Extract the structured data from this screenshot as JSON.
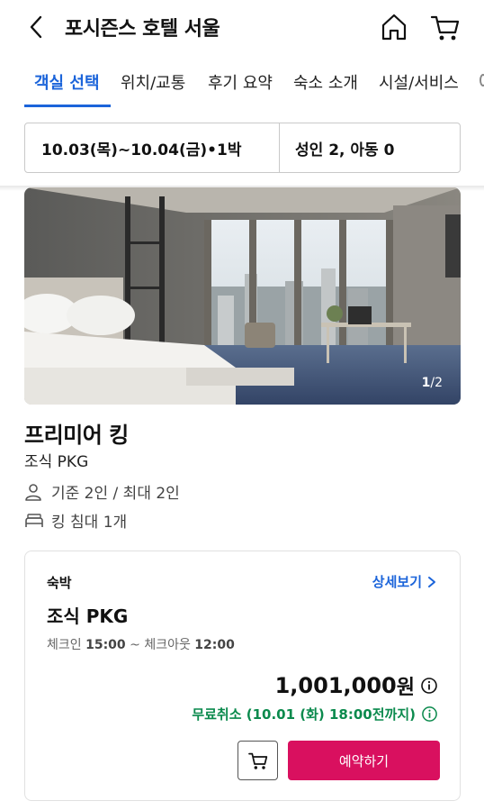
{
  "header": {
    "title": "포시즌스 호텔 서울",
    "back_icon": "chevron-left-icon",
    "home_icon": "home-icon",
    "cart_icon": "cart-icon"
  },
  "tabs": [
    {
      "label": "객실 선택",
      "active": true
    },
    {
      "label": "위치/교통",
      "active": false
    },
    {
      "label": "후기 요약",
      "active": false
    },
    {
      "label": "숙소 소개",
      "active": false
    },
    {
      "label": "시설/서비스",
      "active": false
    }
  ],
  "booking_filter": {
    "dates": "10.03(목)~10.04(금)•1박",
    "guests": "성인 2, 아동 0"
  },
  "room": {
    "image_index": "1",
    "image_total": "/2",
    "name": "프리미어 킹",
    "package": "조식 PKG",
    "occupancy": "기준 2인 / 최대 2인",
    "bed": "킹 침대 1개"
  },
  "rate": {
    "stay_type": "숙박",
    "detail_link": "상세보기",
    "name": "조식 PKG",
    "checkin_label": "체크인",
    "checkin_time": "15:00",
    "separator": "~",
    "checkout_label": "체크아웃",
    "checkout_time": "12:00",
    "price": "1,001,000",
    "currency": "원",
    "cancel_policy": "무료취소 (10.01 (화) 18:00전까지)",
    "book_button": "예약하기"
  },
  "colors": {
    "accent": "#1b64da",
    "book": "#d9105f",
    "cancel": "#0b8a4d"
  }
}
